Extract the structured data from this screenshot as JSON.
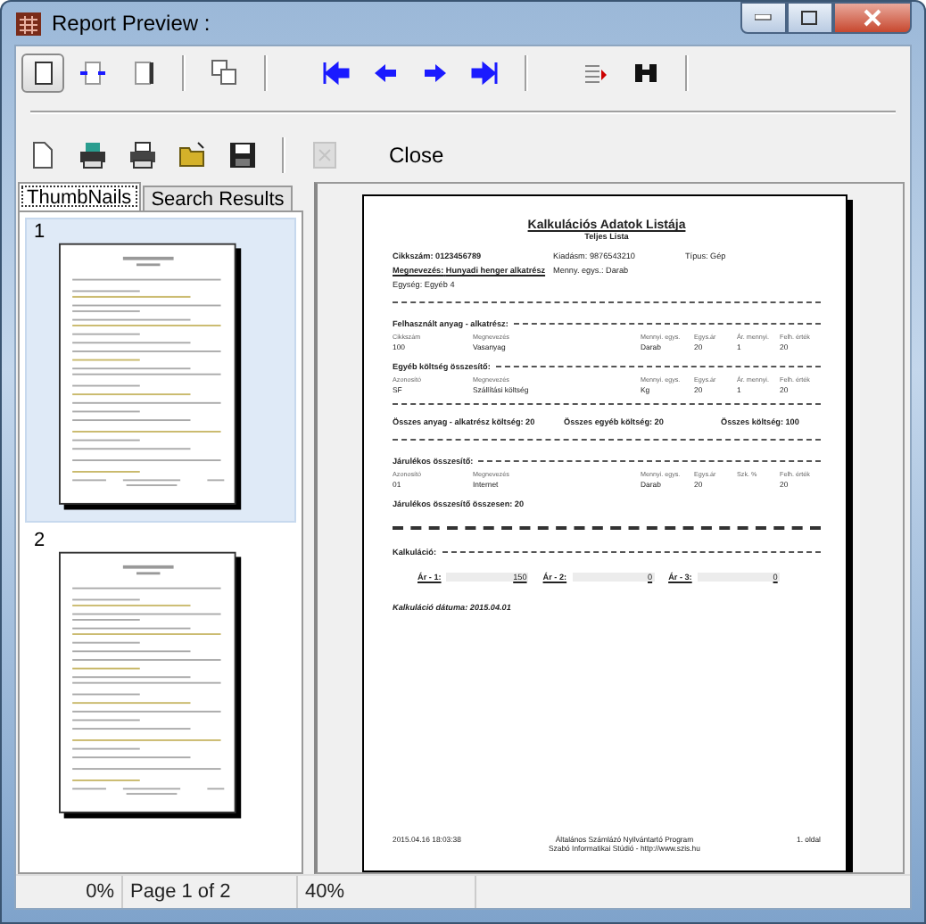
{
  "window": {
    "title": "Report Preview :"
  },
  "toolbar_top": [
    {
      "kind": "single-page",
      "pressed": true
    },
    {
      "kind": "page-width",
      "pressed": false
    },
    {
      "kind": "full-page",
      "pressed": false
    },
    {
      "kind": "separator"
    },
    {
      "kind": "multi-page",
      "pressed": false
    },
    {
      "kind": "separator"
    },
    {
      "kind": "first",
      "pressed": false
    },
    {
      "kind": "previous",
      "pressed": false
    },
    {
      "kind": "next",
      "pressed": false
    },
    {
      "kind": "last",
      "pressed": false
    },
    {
      "kind": "separator"
    },
    {
      "kind": "goto",
      "pressed": false
    },
    {
      "kind": "find",
      "pressed": false
    },
    {
      "kind": "separator"
    }
  ],
  "toolbar_bottom": [
    {
      "kind": "new",
      "disabled": false
    },
    {
      "kind": "print-setup",
      "disabled": false
    },
    {
      "kind": "print",
      "disabled": false
    },
    {
      "kind": "open",
      "disabled": false
    },
    {
      "kind": "save",
      "disabled": false
    },
    {
      "kind": "separator"
    },
    {
      "kind": "export",
      "disabled": true
    },
    {
      "kind": "close",
      "label": "Close",
      "disabled": false
    }
  ],
  "tabs": [
    {
      "label": "ThumbNails",
      "selected": true
    },
    {
      "label": "Search Results",
      "selected": false
    }
  ],
  "thumbnails": [
    {
      "number": "1",
      "selected": true
    },
    {
      "number": "2",
      "selected": false
    }
  ],
  "page": {
    "title": "Kalkulációs Adatok Listája",
    "subtitle": "Teljes Lista",
    "info_rows": [
      [
        {
          "label": "Cikkszám:",
          "value": "0123456789"
        },
        {
          "label": "Kiadásm:",
          "value": "9876543210"
        },
        {
          "label": "Típus:",
          "value": "Gép"
        }
      ],
      [
        {
          "label": "Megnevezés:",
          "value": "Hunyadi henger alkatrész"
        },
        {
          "label": "Menny. egys.:",
          "value": "Darab"
        }
      ],
      [
        {
          "label": "Egység:",
          "value": "Egyéb 4"
        }
      ]
    ],
    "materials": {
      "heading": "Felhasznált anyag - alkatrész:",
      "columns": [
        "Cikkszám",
        "Megnevezés",
        "Mennyi. egys.",
        "Egys.ár",
        "Ár. mennyi.",
        "Felh. érték"
      ],
      "rows": [
        [
          "100",
          "Vasanyag",
          "Darab",
          "20",
          "1",
          "20"
        ]
      ]
    },
    "other_costs": {
      "heading": "Egyéb költség összesítő:",
      "columns": [
        "Azonosító",
        "Megnevezés",
        "Mennyi. egys.",
        "Egys.ár",
        "Ár. mennyi.",
        "Felh. érték"
      ],
      "rows": [
        [
          "SF",
          "Szállítási költség",
          "Kg",
          "20",
          "1",
          "20"
        ]
      ]
    },
    "totals": [
      "Összes anyag - alkatrész költség: 20",
      "Összes egyéb költség: 20",
      "Összes költség: 100"
    ],
    "surcharges": {
      "heading": "Járulékos összesítő:",
      "columns": [
        "Azonosító",
        "Megnevezés",
        "Mennyi. egys.",
        "Egys.ár",
        "Szk. %",
        "Felh. érték"
      ],
      "rows": [
        [
          "01",
          "Internet",
          "Darab",
          "20",
          "",
          "20"
        ]
      ]
    },
    "surcharge_total": "Járulékos összesítő összesen: 20",
    "calculation": {
      "heading": "Kalkuláció:",
      "prices": [
        {
          "label": "Ár - 1:",
          "value": "150"
        },
        {
          "label": "Ár - 2:",
          "value": "0"
        },
        {
          "label": "Ár - 3:",
          "value": "0"
        }
      ]
    },
    "date": {
      "label": "Kalkuláció dátuma:",
      "value": "2015.04.01"
    },
    "footer": {
      "left": "2015.04.16 18:03:38",
      "center": [
        "Általános Számlázó Nyilvántartó Program",
        "Szabó Informatikai Stúdió - http://www.szis.hu"
      ],
      "right": "1. oldal"
    }
  },
  "status_bar": [
    "0%",
    "Page 1 of 2",
    "40%"
  ]
}
